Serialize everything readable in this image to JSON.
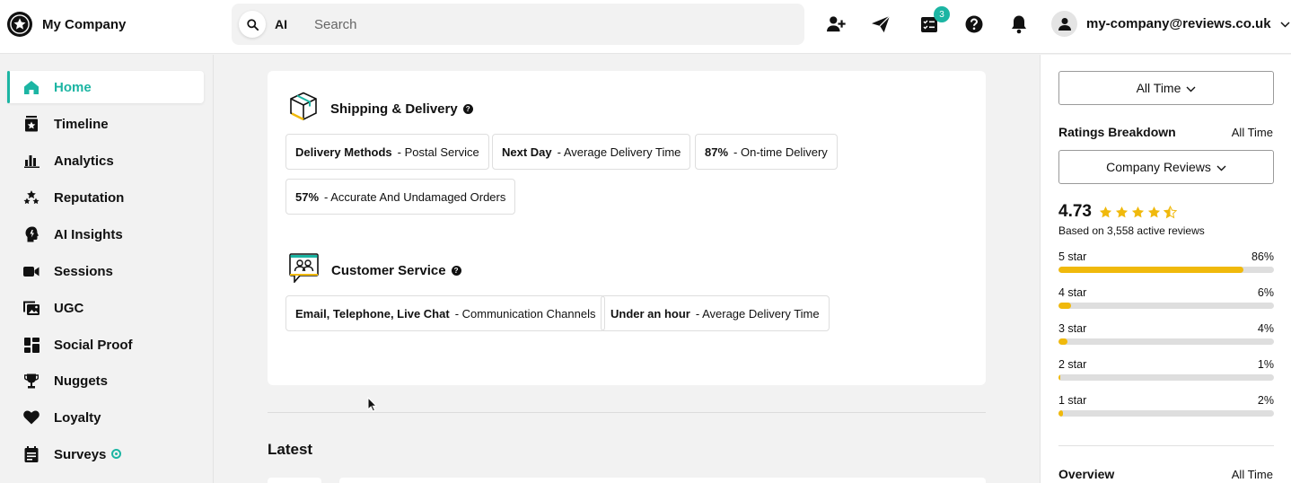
{
  "header": {
    "company_name": "My Company",
    "ai_label": "AI",
    "search_placeholder": "Search",
    "tasks_badge": "3",
    "user_email": "my-company@reviews.co.uk"
  },
  "sidebar": {
    "items": [
      {
        "label": "Home",
        "icon": "home-icon",
        "active": true
      },
      {
        "label": "Timeline",
        "icon": "timeline-icon"
      },
      {
        "label": "Analytics",
        "icon": "bar-chart-icon"
      },
      {
        "label": "Reputation",
        "icon": "stars-icon"
      },
      {
        "label": "AI Insights",
        "icon": "ai-brain-icon"
      },
      {
        "label": "Sessions",
        "icon": "video-camera-icon"
      },
      {
        "label": "UGC",
        "icon": "image-gallery-icon"
      },
      {
        "label": "Social Proof",
        "icon": "widgets-icon"
      },
      {
        "label": "Nuggets",
        "icon": "trophy-icon"
      },
      {
        "label": "Loyalty",
        "icon": "heart-icon"
      },
      {
        "label": "Surveys",
        "icon": "clipboard-icon"
      }
    ]
  },
  "main": {
    "shipping": {
      "title": "Shipping & Delivery",
      "chips": [
        {
          "strong": "Delivery Methods",
          "text": "- Postal Service"
        },
        {
          "strong": "Next Day",
          "text": "- Average Delivery Time"
        },
        {
          "strong": "87%",
          "text": "- On-time Delivery"
        },
        {
          "strong": "57%",
          "text": "- Accurate And Undamaged Orders"
        }
      ]
    },
    "customer_service": {
      "title": "Customer Service",
      "chips": [
        {
          "strong": "Email, Telephone, Live Chat",
          "text": "- Communication Channels"
        },
        {
          "strong": "Under an hour",
          "text": "- Average Delivery Time"
        }
      ]
    },
    "latest_title": "Latest"
  },
  "right_panel": {
    "time_filter": "All Time",
    "ratings_title": "Ratings Breakdown",
    "ratings_period": "All Time",
    "reviews_filter": "Company Reviews",
    "score": "4.73",
    "stars_value": 4.73,
    "based_on": "Based on 3,558 active reviews",
    "breakdown": [
      {
        "label": "5 star",
        "pct_text": "86%",
        "pct": 86
      },
      {
        "label": "4 star",
        "pct_text": "6%",
        "pct": 6
      },
      {
        "label": "3 star",
        "pct_text": "4%",
        "pct": 4
      },
      {
        "label": "2 star",
        "pct_text": "1%",
        "pct": 1
      },
      {
        "label": "1 star",
        "pct_text": "2%",
        "pct": 2
      }
    ],
    "overview_title": "Overview",
    "overview_period": "All Time"
  },
  "colors": {
    "accent": "#1cb5a3",
    "star": "#f0b90c"
  }
}
